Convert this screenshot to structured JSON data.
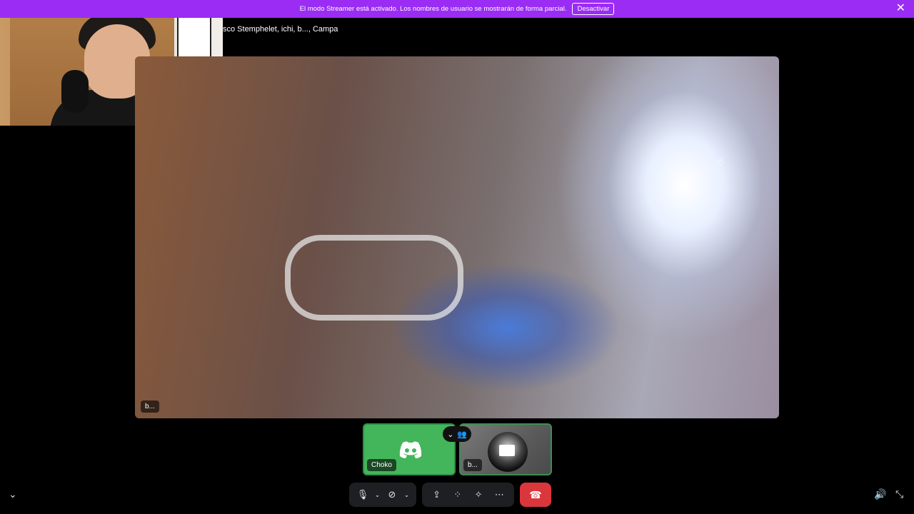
{
  "banner": {
    "text": "El modo Streamer está activado. Los nombres de usuario se mostrarán de forma parcial.",
    "button": "Desactivar",
    "close": "✕"
  },
  "participants_header": "sco Stemphelet, ichi, b..., Campa",
  "main_video": {
    "name": "b..."
  },
  "tiles": [
    {
      "name": "Choko"
    },
    {
      "name": "b..."
    }
  ],
  "icons": {
    "collapse": "⌄",
    "mic": "🎙",
    "camera_off": "⊘",
    "screen_share": "⇪",
    "activities": "⁘",
    "soundboard": "✧",
    "more": "⋯",
    "hangup": "☎",
    "volume": "🔊",
    "fullscreen": "⤡",
    "expand": "⌄"
  },
  "colors": {
    "streamer_banner": "#9a2cf4",
    "hangup": "#da373c",
    "speaking": "#43b55a"
  }
}
